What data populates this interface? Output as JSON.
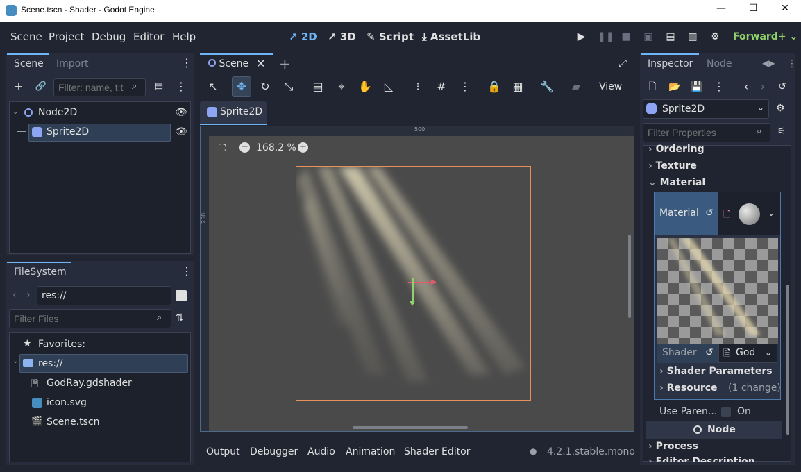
{
  "window": {
    "title": "Scene.tscn - Shader - Godot Engine",
    "minimize": "—",
    "maximize": "☐",
    "close": "✕"
  },
  "menu": [
    "Scene",
    "Project",
    "Debug",
    "Editor",
    "Help"
  ],
  "workspaces": [
    {
      "label": "2D",
      "icon": "↗"
    },
    {
      "label": "3D",
      "icon": "↗"
    },
    {
      "label": "Script",
      "icon": "✎"
    },
    {
      "label": "AssetLib",
      "icon": "⤓"
    }
  ],
  "renderer": "Forward+",
  "scene_dock": {
    "tabs": [
      "Scene",
      "Import"
    ],
    "filter_placeholder": "Filter: name, t:t",
    "tree": [
      {
        "label": "Node2D"
      },
      {
        "label": "Sprite2D"
      }
    ]
  },
  "filesystem": {
    "tab": "FileSystem",
    "path": "res://",
    "filter_placeholder": "Filter Files",
    "favorites": "Favorites:",
    "items": [
      "res://",
      "GodRay.gdshader",
      "icon.svg",
      "Scene.tscn"
    ]
  },
  "viewport": {
    "scene_tab": "Scene",
    "subtab": "Sprite2D",
    "zoom": "168.2 %",
    "view_menu": "View",
    "ruler_top": "500",
    "ruler_left": "250"
  },
  "inspector": {
    "tabs": [
      "Inspector",
      "Node"
    ],
    "object": "Sprite2D",
    "filter_placeholder": "Filter Properties",
    "sections": [
      "Ordering",
      "Texture",
      "Material"
    ],
    "material_label": "Material",
    "shader_label": "Shader",
    "shader_value": "God",
    "subsections": [
      "Shader Parameters",
      "Resource"
    ],
    "resource_note": "(1 change)",
    "use_parent_label": "Use Paren...",
    "use_parent_value": "On",
    "node_header": "Node",
    "more_sections": [
      "Process",
      "Editor Description"
    ]
  },
  "bottom_panel": {
    "tabs": [
      "Output",
      "Debugger",
      "Audio",
      "Animation",
      "Shader Editor"
    ],
    "version": "4.2.1.stable.mono"
  },
  "colors": {
    "accent": "#6fb5f5",
    "selection_border": "#e8925a",
    "panel": "#262c3b",
    "background": "#202531"
  }
}
